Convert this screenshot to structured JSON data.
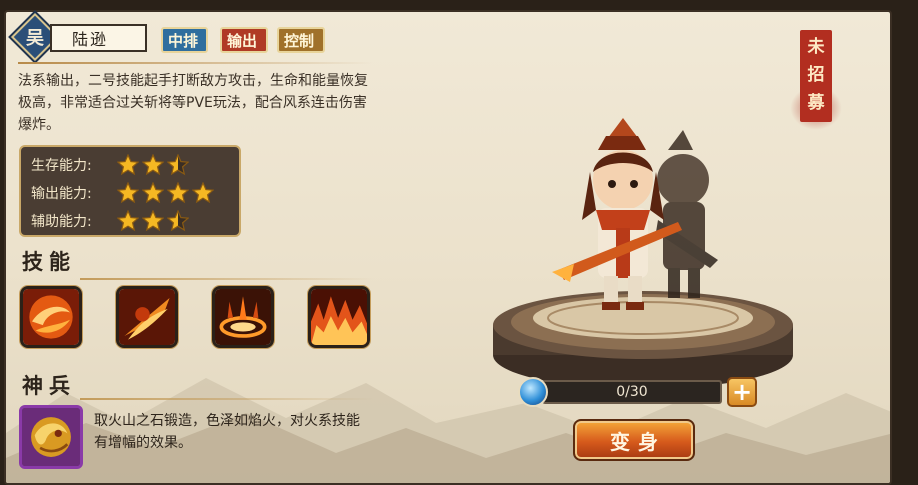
{
  "hero": {
    "faction": "吴",
    "name": "陆逊",
    "tags": [
      {
        "label": "中排",
        "color": "#2f6e9e"
      },
      {
        "label": "输出",
        "color": "#b03a25"
      },
      {
        "label": "控制",
        "color": "#a0712a"
      }
    ],
    "description": "法系输出，二号技能起手打断敌方攻击，生命和能量恢复极高，非常适合过关斩将等PVE玩法，配合风系连击伤害爆炸。"
  },
  "abilities": [
    {
      "label": "生存能力:",
      "stars": 2.5
    },
    {
      "label": "输出能力:",
      "stars": 4
    },
    {
      "label": "辅助能力:",
      "stars": 2.5
    }
  ],
  "skills": {
    "title": "技能",
    "items": [
      {
        "icon": "fire-swirl-icon"
      },
      {
        "icon": "flame-strike-icon"
      },
      {
        "icon": "fire-ring-icon"
      },
      {
        "icon": "fire-wall-icon"
      }
    ]
  },
  "weapon": {
    "title": "神兵",
    "icon": "dragon-weapon-icon",
    "description": "取火山之石锻造，色泽如焰火，对火系技能有增幅的效果。"
  },
  "recruit_status": "未招募",
  "fragments": {
    "progress": "0/30",
    "current": 0,
    "required": 30
  },
  "transform_button": "变身",
  "colors": {
    "panel": "#ebe1cb",
    "accent_red": "#b22e20",
    "star_gold": "#f5b823"
  }
}
